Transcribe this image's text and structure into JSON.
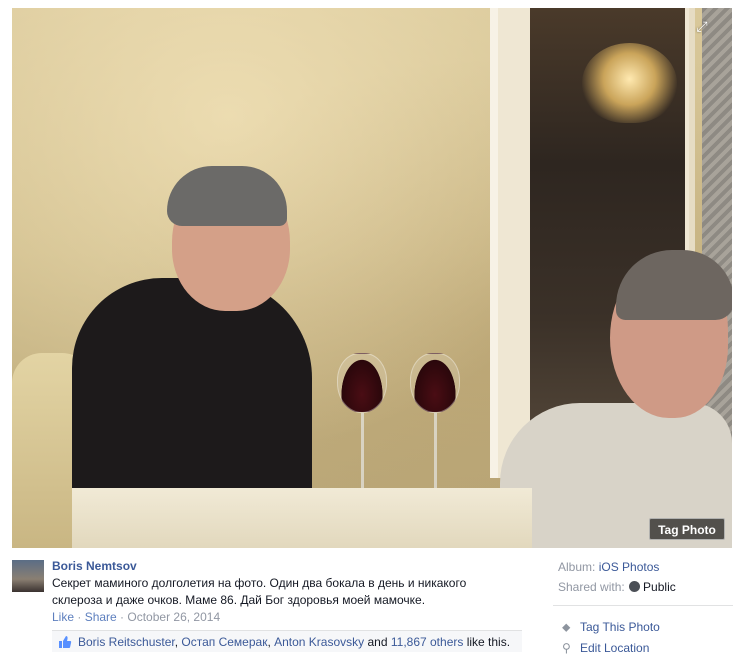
{
  "post": {
    "author": "Boris Nemtsov",
    "caption_line1": "Секрет маминого долголетия на фото. Один два бокала в день и никакого",
    "caption_line2": "склероза и даже очков. Маме 86. Дай Бог здоровья моей мамочке.",
    "like_label": "Like",
    "separator": " · ",
    "share_label": "Share",
    "date": "October 26, 2014"
  },
  "likes": {
    "name1": "Boris Reitschuster",
    "comma": ", ",
    "name2": "Остап Семерак",
    "name3": "Anton Krasovsky",
    "and": " and ",
    "others": "11,867 others",
    "suffix": " like this."
  },
  "photo": {
    "tag_button": "Tag Photo",
    "expand_icon": "expand-icon"
  },
  "sidebar": {
    "album_label": "Album: ",
    "album_value": "iOS Photos",
    "shared_label": "Shared with: ",
    "shared_value": "Public",
    "tag_action": "Tag This Photo",
    "location_action": "Edit Location"
  },
  "colors": {
    "link": "#3b5998",
    "meta": "#9197a3"
  }
}
